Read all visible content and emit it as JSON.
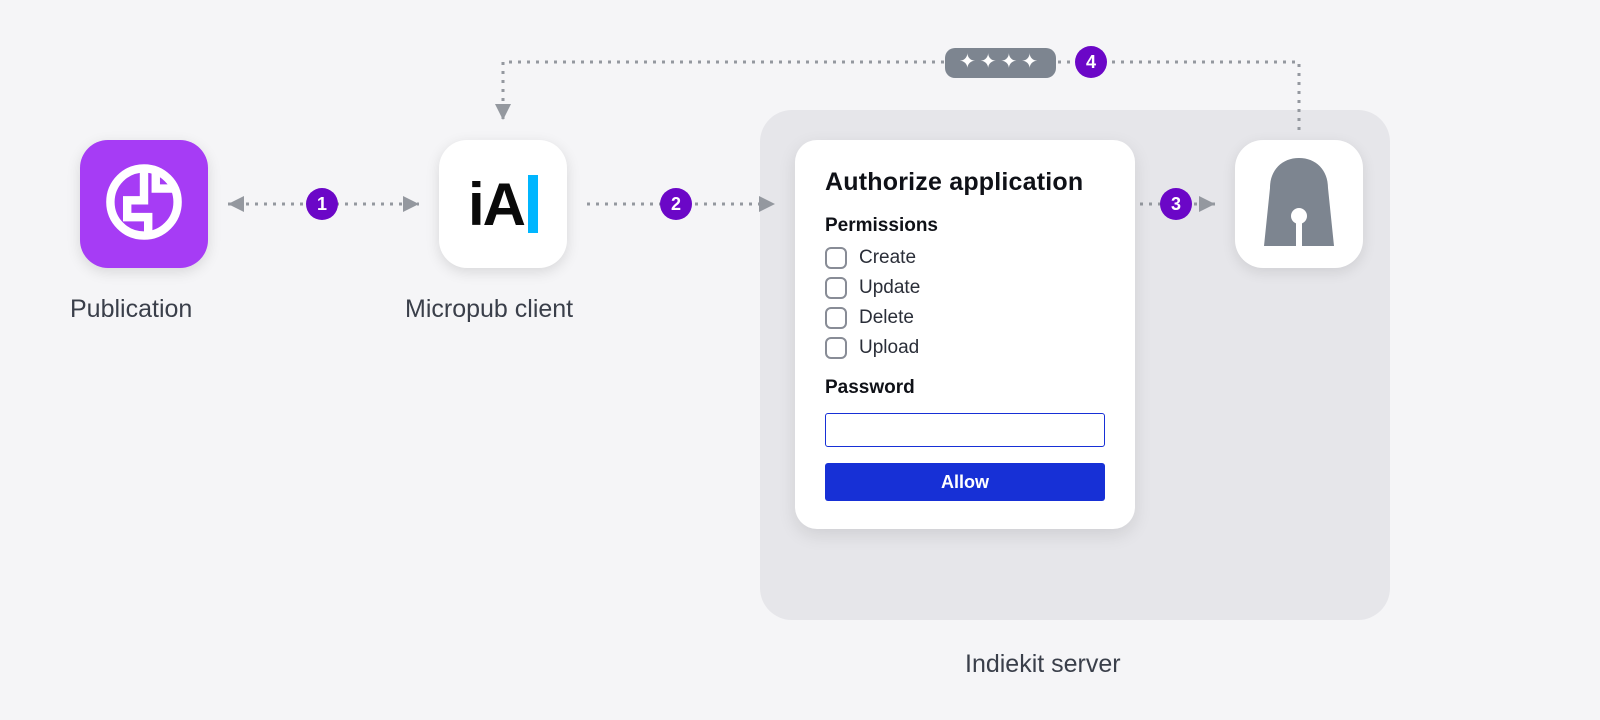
{
  "nodes": {
    "publication_label": "Publication",
    "micropub_label": "Micropub client",
    "micropub_logo_text": "iA",
    "server_label": "Indiekit server"
  },
  "steps": {
    "one": "1",
    "two": "2",
    "three": "3",
    "four": "4"
  },
  "token_glyphs": "✦✦✦✦",
  "auth_card": {
    "title": "Authorize application",
    "permissions_label": "Permissions",
    "permissions": [
      "Create",
      "Update",
      "Delete",
      "Upload"
    ],
    "password_label": "Password",
    "allow_label": "Allow"
  }
}
